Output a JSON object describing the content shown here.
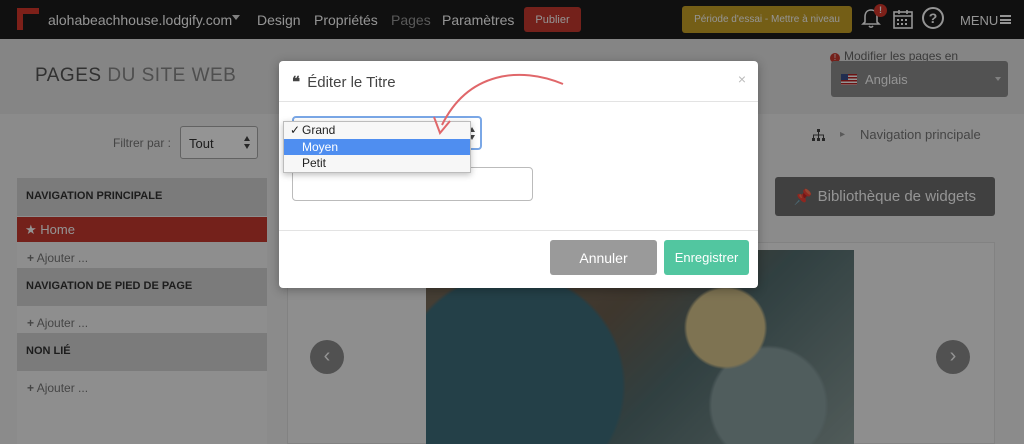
{
  "topbar": {
    "site": "alohabeachhouse.lodgify.com",
    "nav": [
      "Design",
      "Propriétés",
      "Pages",
      "Paramètres"
    ],
    "publish": "Publier",
    "trial": "Période d'essai - Mettre à niveau",
    "notif_count": "!",
    "help": "?",
    "menu": "MENU"
  },
  "header": {
    "title_strong": "PAGES",
    "title_light": "DU SITE WEB",
    "modify_label": "Modifier les pages en",
    "language": "Anglais"
  },
  "filter": {
    "label": "Filtrer par :",
    "value": "Tout"
  },
  "sidebar": {
    "main_nav": "NAVIGATION PRINCIPALE",
    "home": "Home",
    "add": "Ajouter ...",
    "footer_nav": "NAVIGATION DE PIED DE PAGE",
    "unlinked": "NON LIÉ"
  },
  "breadcrumb": {
    "sep": "▸",
    "text": "Navigation principale"
  },
  "widgets_button": "Bibliothèque de widgets",
  "carousel": {
    "prev": "‹",
    "next": "›"
  },
  "modal": {
    "title": "Éditer le Titre",
    "quote_icon": "❝",
    "close": "×",
    "size_options": [
      "Grand",
      "Moyen",
      "Petit"
    ],
    "checked": "✓",
    "cancel": "Annuler",
    "save": "Enregistrer"
  },
  "colors": {
    "accent_red": "#c9392f",
    "save_green": "#52c6a0",
    "trial_gold": "#c9a227",
    "annotation": "#e0676a"
  }
}
